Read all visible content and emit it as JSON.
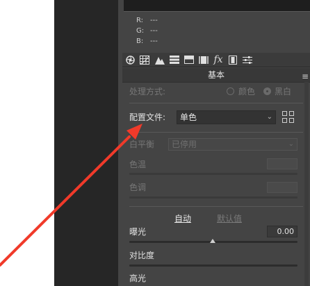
{
  "rgb_readout": [
    {
      "channel": "R:",
      "value": "---"
    },
    {
      "channel": "G:",
      "value": "---"
    },
    {
      "channel": "B:",
      "value": "---"
    }
  ],
  "tabs": [
    {
      "name": "basic-tab",
      "icon": "aperture-icon"
    },
    {
      "name": "tone-curve-tab",
      "icon": "grid-curve-icon"
    },
    {
      "name": "detail-tab",
      "icon": "mountain-icon"
    },
    {
      "name": "hsl-tab",
      "icon": "stripes-icon"
    },
    {
      "name": "split-toning-tab",
      "icon": "split-box-icon"
    },
    {
      "name": "lens-tab",
      "icon": "lens-icon"
    },
    {
      "name": "effects-tab",
      "icon": "fx-icon",
      "label": "fx"
    },
    {
      "name": "calibration-tab",
      "icon": "film-icon"
    },
    {
      "name": "presets-tab",
      "icon": "sliders-icon"
    }
  ],
  "section_title": "基本",
  "menu_icon": "≡",
  "process": {
    "label": "处理方式:",
    "option_color": "颜色",
    "option_bw": "黑白",
    "selected": "黑白"
  },
  "profile": {
    "label": "配置文件:",
    "value": "单色",
    "caret": "⌄"
  },
  "white_balance": {
    "label": "白平衡",
    "value": "已停用",
    "caret": "⌄"
  },
  "temperature": {
    "label": "色温"
  },
  "tint": {
    "label": "色调"
  },
  "auto_label": "自动",
  "default_label": "默认值",
  "exposure": {
    "label": "曝光",
    "value": "0.00",
    "level": 0.5
  },
  "contrast": {
    "label": "对比度"
  },
  "highlights": {
    "label": "高光"
  },
  "colors": {
    "panel": "#444444",
    "annotation_arrow": "#f03a2a"
  }
}
